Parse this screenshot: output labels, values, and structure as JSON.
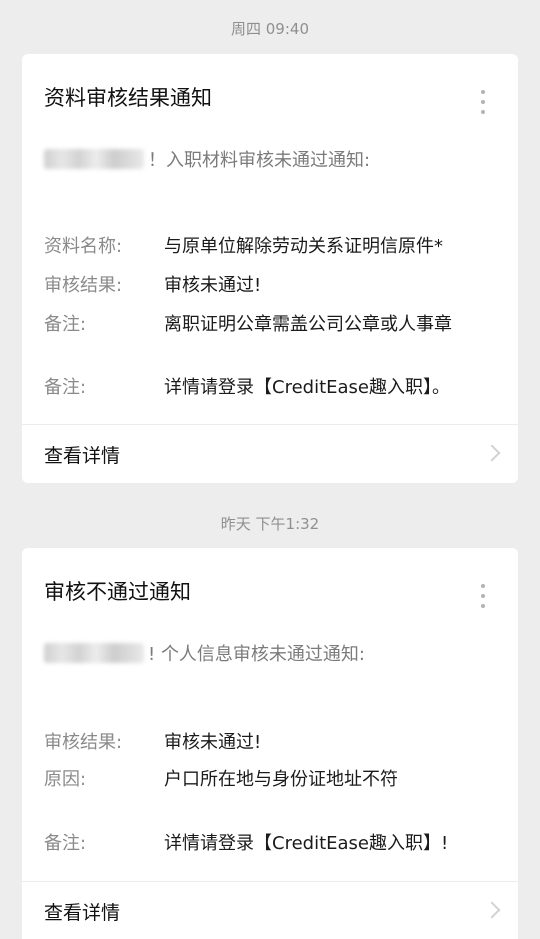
{
  "messages": [
    {
      "timestamp": "周四 09:40",
      "title": "资料审核结果通知",
      "greeting_suffix": "！入职材料审核未通过通知:",
      "fields": [
        {
          "label": "资料名称:",
          "value": "与原单位解除劳动关系证明信原件*"
        },
        {
          "label": "审核结果:",
          "value": "审核未通过!"
        },
        {
          "label": "备注:",
          "value": "离职证明公章需盖公司公章或人事章"
        },
        {
          "label": "备注:",
          "value": "详情请登录【CreditEase趣入职】。"
        }
      ],
      "details_label": "查看详情"
    },
    {
      "timestamp": "昨天 下午1:32",
      "title": "审核不通过通知",
      "greeting_suffix": "! 个人信息审核未通过通知:",
      "fields": [
        {
          "label": "审核结果:",
          "value": "审核未通过!"
        },
        {
          "label": "原因:",
          "value": "户口所在地与身份证地址不符"
        },
        {
          "label": "备注:",
          "value": "详情请登录【CreditEase趣入职】!"
        }
      ],
      "details_label": "查看详情"
    }
  ],
  "icons": {
    "more": "more-vertical-icon",
    "chevron": "chevron-right-icon"
  },
  "colors": {
    "background": "#ededed",
    "card": "#ffffff",
    "label": "#8a8a8a",
    "value": "#1b1b1b",
    "timestamp": "#8f8f8f"
  }
}
